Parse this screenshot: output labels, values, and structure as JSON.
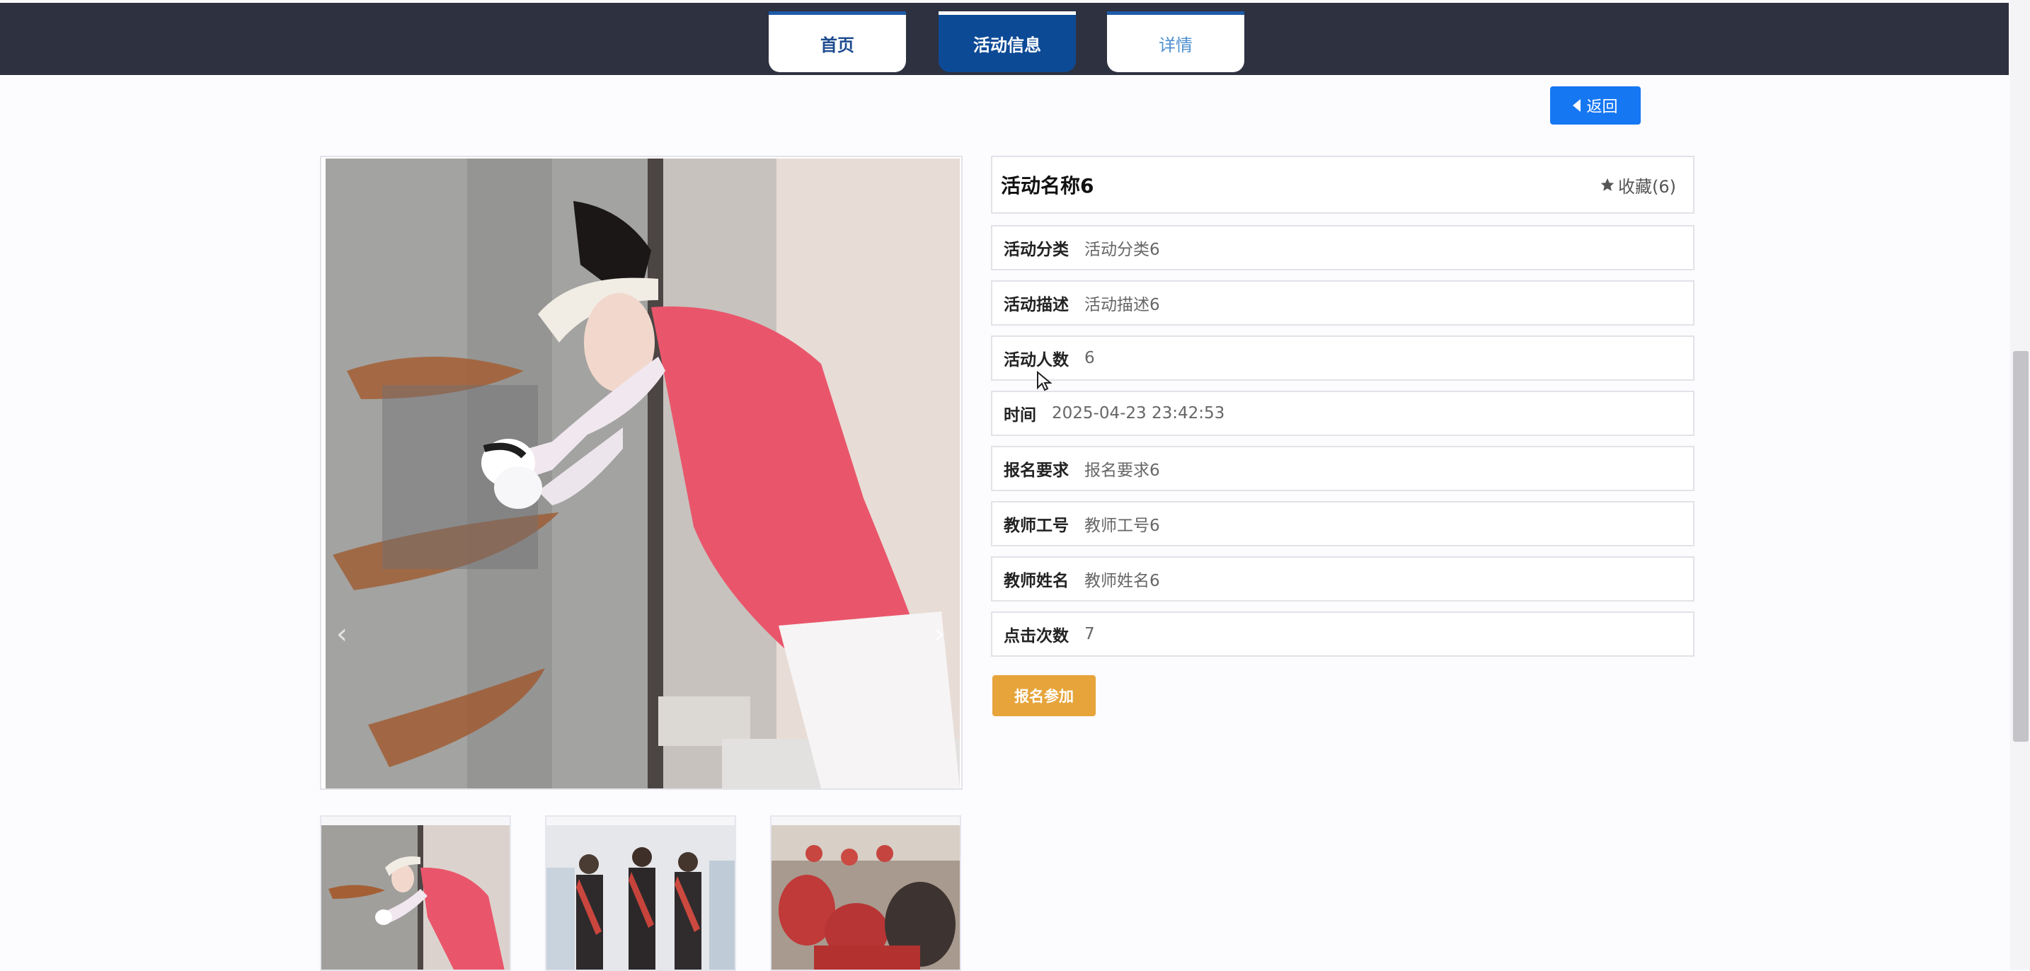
{
  "nav": {
    "tabs": [
      {
        "label": "首页"
      },
      {
        "label": "活动信息"
      },
      {
        "label": "详情"
      }
    ]
  },
  "back_button": {
    "label": "返回"
  },
  "activity": {
    "title": "活动名称6",
    "favorite_label": "收藏(6)",
    "fields": [
      {
        "label": "活动分类",
        "value": "活动分类6"
      },
      {
        "label": "活动描述",
        "value": "活动描述6"
      },
      {
        "label": "活动人数",
        "value": "6"
      },
      {
        "label": "时间",
        "value": "2025-04-23 23:42:53"
      },
      {
        "label": "报名要求",
        "value": "报名要求6"
      },
      {
        "label": "教师工号",
        "value": "教师工号6"
      },
      {
        "label": "教师姓名",
        "value": "教师姓名6"
      },
      {
        "label": "点击次数",
        "value": "7"
      }
    ]
  },
  "signup_button": {
    "label": "报名参加"
  },
  "gallery": {
    "prev_icon": "‹",
    "next_icon": "›",
    "thumbnails": [
      "volunteer-cleaning-wall",
      "volunteers-in-red-sashes",
      "volunteers-outdoor-event"
    ]
  },
  "colors": {
    "topbar": "#2d3140",
    "nav_active": "#0d4a96",
    "back_button": "#1677f2",
    "signup_button": "#e6a43a"
  }
}
